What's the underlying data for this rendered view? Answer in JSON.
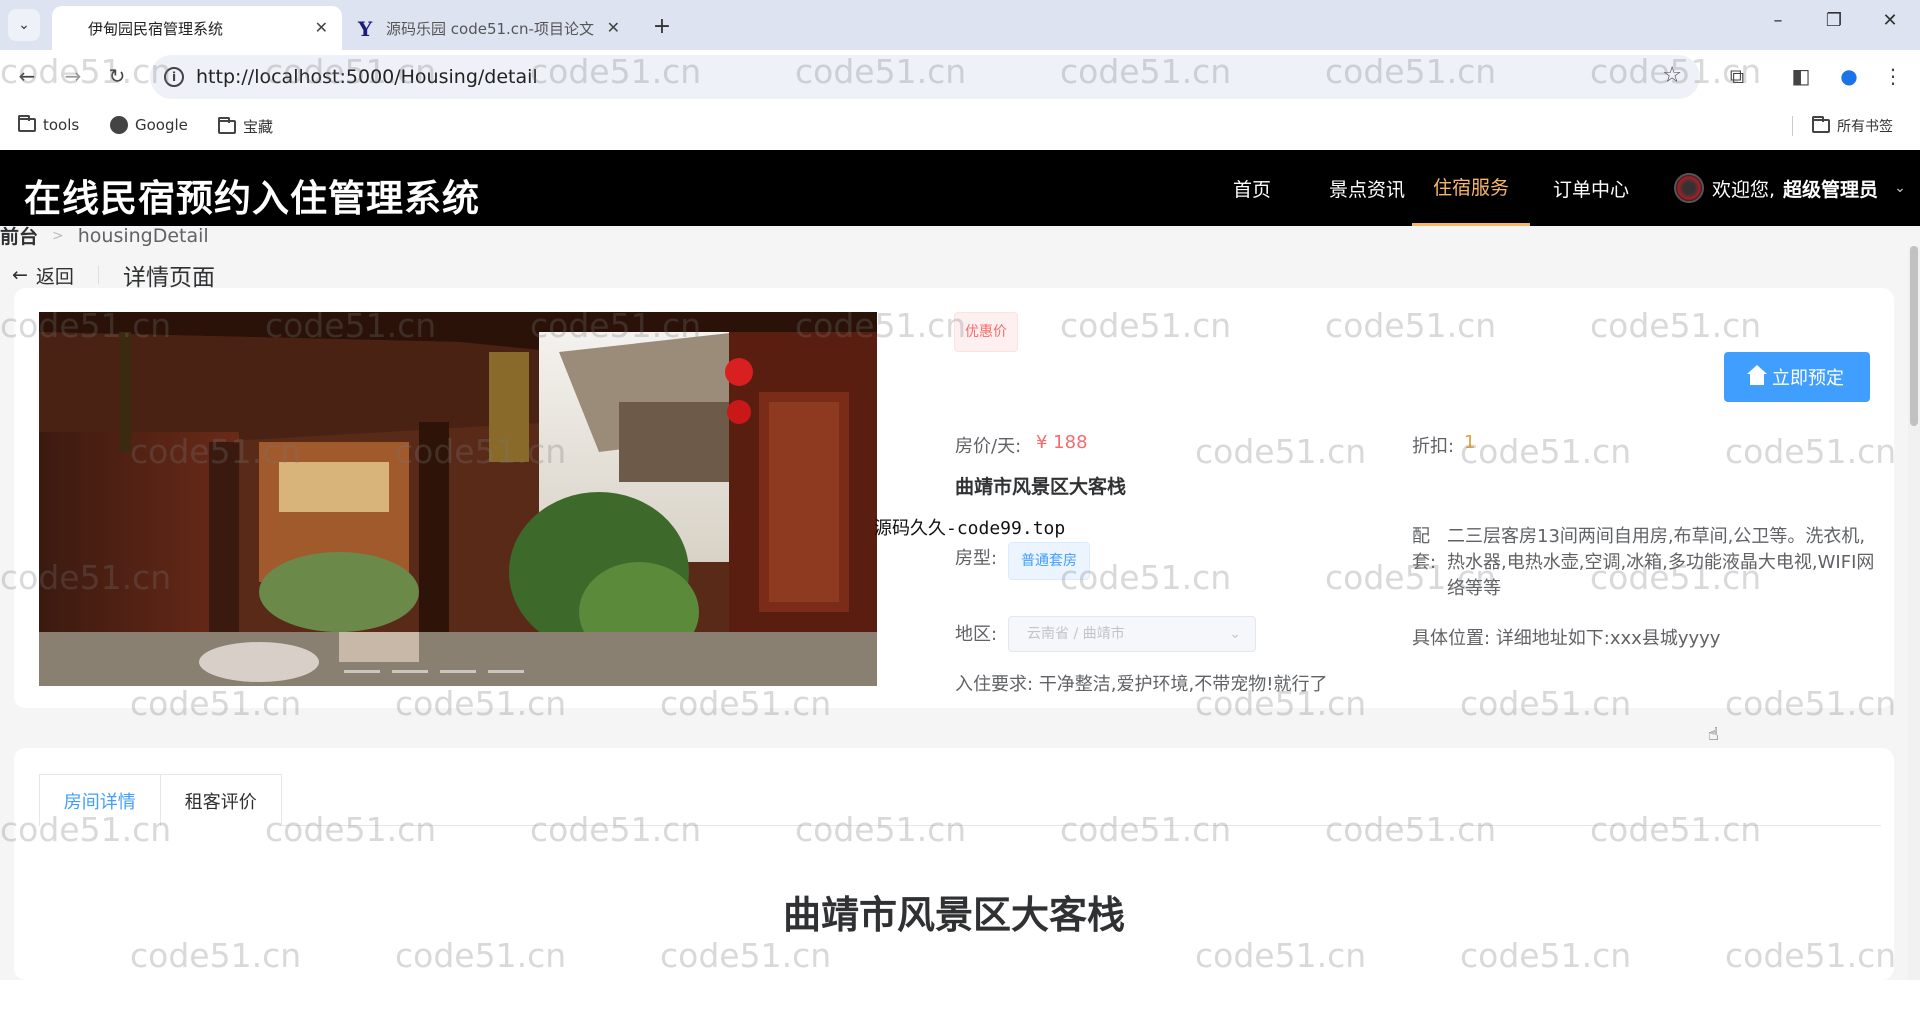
{
  "browser": {
    "tabs": [
      {
        "title": "伊甸园民宿管理系统",
        "active": true
      },
      {
        "title": "源码乐园 code51.cn-项目论文",
        "active": false
      }
    ],
    "url": "http://localhost:5000/Housing/detail",
    "bookmarks": [
      "tools",
      "Google",
      "宝藏"
    ],
    "all_bookmarks": "所有书签"
  },
  "app": {
    "title": "在线民宿预约入住管理系统",
    "nav": [
      "首页",
      "景点资讯",
      "住宿服务",
      "订单中心"
    ],
    "active_nav": "住宿服务",
    "welcome": "欢迎您,",
    "user": "超级管理员"
  },
  "breadcrumb": {
    "home": "前台",
    "current": "housingDetail"
  },
  "page_header": {
    "back": "返回",
    "title": "详情页面"
  },
  "detail": {
    "badge": "优惠价",
    "book_button": "立即预定",
    "price_label": "房价/天:",
    "price_value": "¥ 188",
    "discount_label": "折扣:",
    "discount_value": "1",
    "name": "曲靖市风景区大客栈",
    "overlay_text": "源码久久-code99.top",
    "type_label": "房型:",
    "type_value": "普通套房",
    "facility_label": "配套:",
    "facility_value": "二三层客房13间两间自用房,布草间,公卫等。洗衣机,热水器,电热水壶,空调,冰箱,多功能液晶大电视,WIFI网络等等",
    "region_label": "地区:",
    "region_value": "云南省 / 曲靖市",
    "location_label": "具体位置:",
    "location_value": "详细地址如下:xxx县城yyyy",
    "requirement_label": "入住要求:",
    "requirement_value": "干净整洁,爱护环境,不带宠物!就行了"
  },
  "tabs": [
    "房间详情",
    "租客评价"
  ],
  "active_tab": "房间详情",
  "content_title": "曲靖市风景区大客栈",
  "watermark": "code51.cn",
  "colors": {
    "primary": "#409eff",
    "danger": "#f56c6c",
    "warning": "#e6a23c",
    "header_bg": "#000000",
    "nav_active": "#f6b867"
  }
}
